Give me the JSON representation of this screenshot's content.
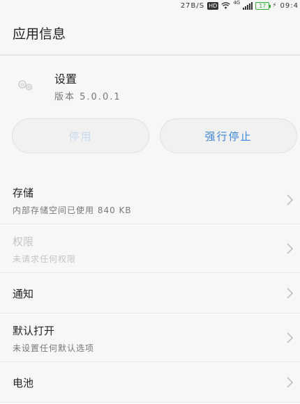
{
  "status_bar": {
    "speed": "27B/S",
    "hd": "HD",
    "network": "4G",
    "battery": "17",
    "time": "09:4"
  },
  "header": {
    "title": "应用信息"
  },
  "app": {
    "name": "设置",
    "version": "版本 5.0.0.1",
    "icon": "settings-gears-icon"
  },
  "buttons": {
    "disable": "停用",
    "force_stop": "强行停止"
  },
  "list": [
    {
      "title": "存储",
      "subtitle": "内部存储空间已使用 840 KB",
      "enabled": true
    },
    {
      "title": "权限",
      "subtitle": "未请求任何权限",
      "enabled": false
    },
    {
      "title": "通知",
      "subtitle": "",
      "enabled": true
    },
    {
      "title": "默认打开",
      "subtitle": "未设置任何默认选项",
      "enabled": true
    },
    {
      "title": "电池",
      "subtitle": "",
      "enabled": true
    }
  ],
  "colors": {
    "accent": "#3b86db",
    "disabled_text": "#c7d9ee",
    "background": "#f7f7f7"
  }
}
